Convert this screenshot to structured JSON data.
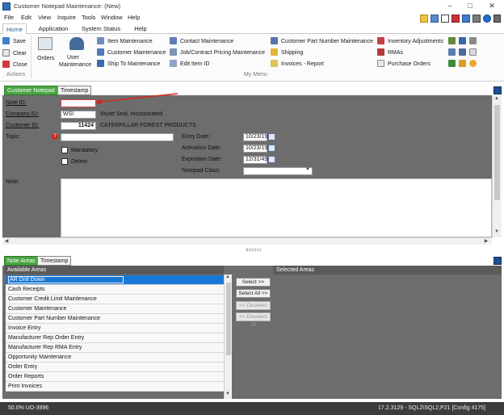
{
  "window": {
    "title": "Customer Notepad Maintenance: (New)",
    "controls": [
      "–",
      "□",
      "✕"
    ]
  },
  "menu": [
    "File",
    "Edit",
    "View",
    "Inquire",
    "Tools",
    "Window",
    "Help"
  ],
  "ribbon": {
    "tabs": [
      "Home",
      "Application",
      "System Status",
      "Help"
    ],
    "actions": {
      "save": "Save",
      "clear": "Clear",
      "close": "Close",
      "group": "Actions"
    },
    "orders": "Orders",
    "user_maintenance": [
      "User",
      "Maintenance"
    ],
    "col1": [
      "Item Maintenance",
      "Customer Maintenance",
      "Ship To Maintenance"
    ],
    "col2": [
      "Contact Maintenance",
      "Job/Contract Pricing Maintenance",
      "Edit Item ID"
    ],
    "col3": [
      "Customer Part Number Maintenance",
      "Shipping",
      "Invoices - Report"
    ],
    "col4": [
      "Inventory Adjustments",
      "RMAs",
      "Purchase Orders"
    ],
    "mymenu": "My Menu"
  },
  "upper_panel": {
    "tabs": [
      "Customer Notepad",
      "Timestamp"
    ],
    "labels": {
      "note_id": "Note ID:",
      "company_id": "Company ID:",
      "customer_id": "Customer ID:",
      "topic": "Topic:",
      "mandatory": "Mandatory",
      "delete": "Delete",
      "note": "Note:",
      "entry_date": "Entry Date:",
      "activation_date": "Activation Date:",
      "expiration_date": "Expiration Date:",
      "notepad_class": "Notepad Class:"
    },
    "values": {
      "note_id": "",
      "company_id": "WSI",
      "company_name": "Wyatt Seal, Incorporated",
      "customer_id": "11424",
      "customer_name": "CATERPILLAR FOREST PRODUCTS",
      "topic": "",
      "entry_date": "10/23/19",
      "activation_date": "10/23/19",
      "expiration_date": "12/31/49",
      "notepad_class": "",
      "note": ""
    },
    "required_marker": "?",
    "annotation_color": "#d9261c"
  },
  "lower_panel": {
    "tabs": [
      "Note Areas",
      "Timestamp"
    ],
    "available_header": "Available Areas",
    "selected_header": "Selected Areas",
    "available": [
      "AR Drill Down",
      "Cash Receipts",
      "Customer Credit Limit Maintenance",
      "Customer Maintenance",
      "Customer Part Number Maintenance",
      "Invoice Entry",
      "Manufacturer Rep Order Entry",
      "Manufacturer Rep RMA Entry",
      "Opportunity Maintenance",
      "Order Entry",
      "Order Reports",
      "Print Invoices"
    ],
    "selected_index": 0,
    "buttons": [
      "Select >>",
      "Select All >>",
      "<< Deselect",
      "<< Deselect All"
    ]
  },
  "status": {
    "left": "50.0% UO-3996",
    "right": "17.2.3129 - SQL2\\SQL2,P21 [Config 4175]"
  }
}
